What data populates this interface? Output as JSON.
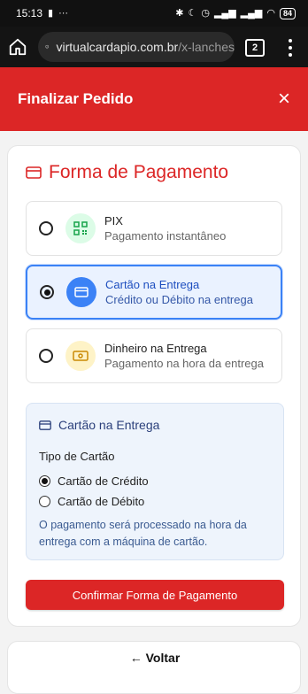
{
  "status_bar": {
    "time": "15:13",
    "battery": "84"
  },
  "browser": {
    "url_host": "virtualcardapio.com.br",
    "url_path": "/x-lanches",
    "tab_count": "2"
  },
  "modal": {
    "title": "Finalizar Pedido",
    "close_symbol": "×"
  },
  "payment": {
    "title": "Forma de Pagamento",
    "options": [
      {
        "title": "PIX",
        "subtitle": "Pagamento instantâneo",
        "icon": "qr-code-icon",
        "selected": false
      },
      {
        "title": "Cartão na Entrega",
        "subtitle": "Crédito ou Débito na entrega",
        "icon": "credit-card-icon",
        "selected": true
      },
      {
        "title": "Dinheiro na Entrega",
        "subtitle": "Pagamento na hora da entrega",
        "icon": "cash-icon",
        "selected": false
      }
    ]
  },
  "card_panel": {
    "title": "Cartão na Entrega",
    "type_label": "Tipo de Cartão",
    "options": [
      {
        "label": "Cartão de Crédito",
        "selected": true
      },
      {
        "label": "Cartão de Débito",
        "selected": false
      }
    ],
    "note": "O pagamento será processado na hora da entrega com a máquina de cartão."
  },
  "confirm_label": "Confirmar Forma de Pagamento",
  "back_label": "← Voltar",
  "colors": {
    "brand_red": "#dc2626",
    "selected_blue": "#3b82f6",
    "pix_green": "#dcfce7",
    "card_blue": "#3b82f6",
    "cash_yellow": "#fef3c7"
  }
}
